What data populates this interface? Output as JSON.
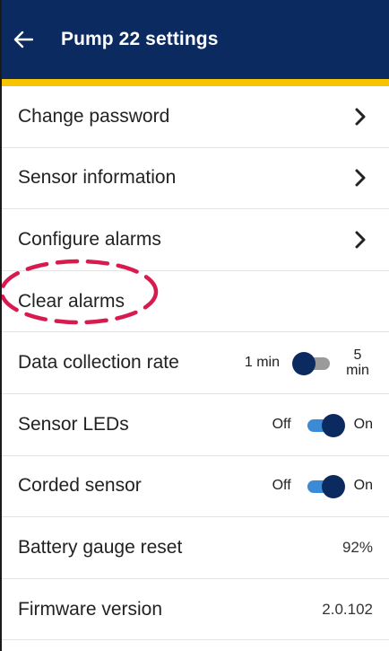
{
  "header": {
    "title": "Pump 22 settings",
    "back_icon": "arrow-left-icon",
    "background_color": "#0b2a5f",
    "accent_color": "#f6c400"
  },
  "rows": {
    "change_password": {
      "label": "Change password",
      "icon": "chevron-right-icon"
    },
    "sensor_information": {
      "label": "Sensor information",
      "icon": "chevron-right-icon"
    },
    "configure_alarms": {
      "label": "Configure alarms",
      "icon": "chevron-right-icon"
    },
    "clear_alarms": {
      "label": "Clear alarms",
      "highlight_color": "#d81b4f"
    },
    "data_collection_rate": {
      "label": "Data collection rate",
      "left_option": "1 min",
      "right_option_value": "5",
      "right_option_unit": "min",
      "selected": "1 min"
    },
    "sensor_leds": {
      "label": "Sensor LEDs",
      "off_label": "Off",
      "on_label": "On",
      "state": "On"
    },
    "corded_sensor": {
      "label": "Corded sensor",
      "off_label": "Off",
      "on_label": "On",
      "state": "On"
    },
    "battery_gauge_reset": {
      "label": "Battery gauge reset",
      "value": "92%"
    },
    "firmware_version": {
      "label": "Firmware version",
      "value": "2.0.102"
    }
  }
}
